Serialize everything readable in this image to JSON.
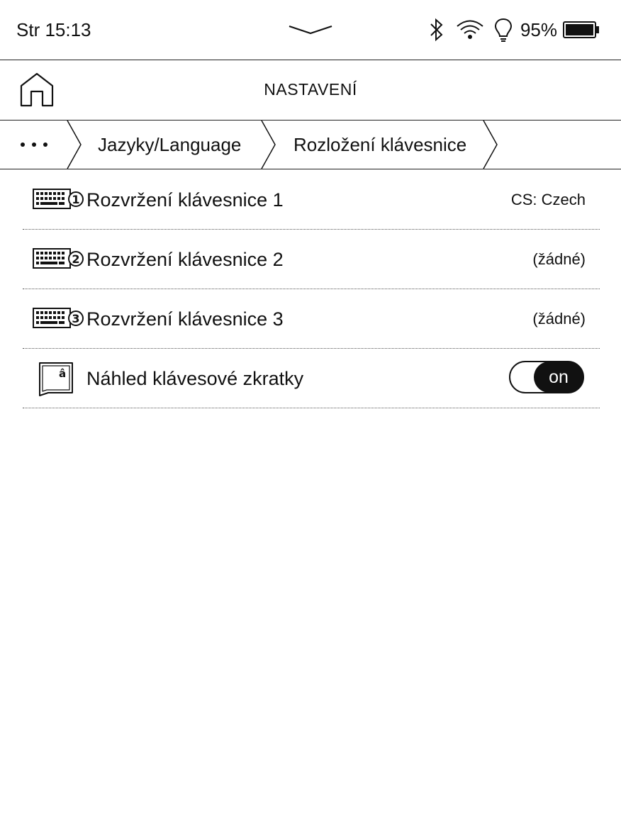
{
  "status_bar": {
    "time": "Str 15:13",
    "battery_percent": "95%",
    "icons": [
      "bluetooth-icon",
      "wifi-icon",
      "frontlight-icon",
      "battery-icon"
    ]
  },
  "header": {
    "title": "NASTAVENÍ",
    "home_icon": "home-icon"
  },
  "breadcrumb": {
    "more": "more-dots-icon",
    "items": [
      {
        "label": "Jazyky/Language"
      },
      {
        "label": "Rozložení klávesnice"
      }
    ]
  },
  "settings": [
    {
      "label": "Rozvržení klávesnice 1",
      "value": "CS: Czech",
      "icon": "keyboard-1-icon"
    },
    {
      "label": "Rozvržení klávesnice 2",
      "value": "(žádné)",
      "icon": "keyboard-2-icon"
    },
    {
      "label": "Rozvržení klávesnice 3",
      "value": "(žádné)",
      "icon": "keyboard-3-icon"
    },
    {
      "label": "Náhled klávesové zkratky",
      "toggle": "on",
      "icon": "key-preview-icon"
    }
  ],
  "colors": {
    "text": "#111111",
    "background": "#ffffff",
    "toggle_on": "#111111"
  }
}
